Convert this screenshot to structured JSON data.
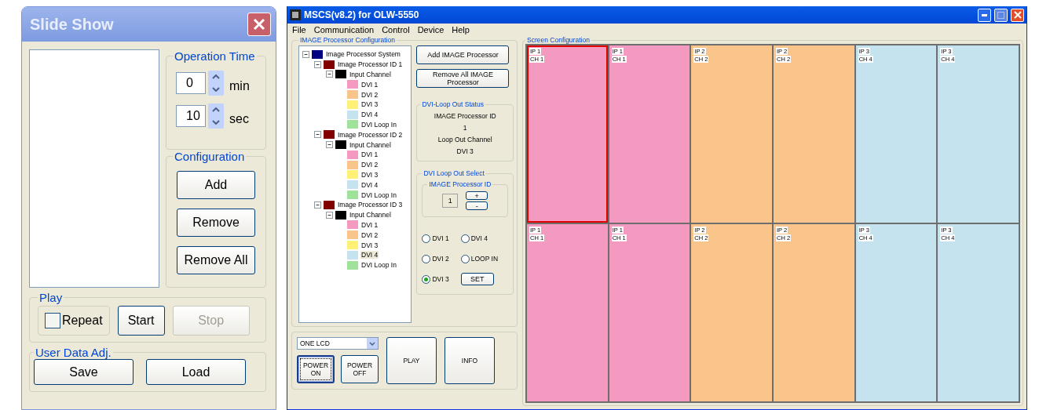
{
  "slide_show": {
    "title": "Slide Show",
    "operation_time": {
      "label": "Operation Time",
      "fields": [
        {
          "value": "0",
          "unit": "min"
        },
        {
          "value": "10",
          "unit": "sec"
        }
      ]
    },
    "configuration": {
      "label": "Configuration",
      "buttons": [
        "Add",
        "Remove",
        "Remove All"
      ]
    },
    "play": {
      "label": "Play",
      "repeat": {
        "label": "Repeat",
        "checked": false
      },
      "buttons": [
        {
          "label": "Start",
          "disabled": false
        },
        {
          "label": "Stop",
          "disabled": true
        }
      ]
    },
    "user_data": {
      "label": "User Data Adj.",
      "buttons": [
        "Save",
        "Load"
      ]
    }
  },
  "main": {
    "title": "MSCS(v8.2) for OLW-5550",
    "menu": [
      "File",
      "Communication",
      "Control",
      "Device",
      "Help"
    ],
    "image_processor_config": {
      "label": "IMAGE  Processor  Configuration",
      "tree": [
        {
          "label": "Image Processor System",
          "color": "#000080",
          "expanded": true,
          "selected": false,
          "children": [
            {
              "label": "Image Processor ID 1",
              "color": "#800000",
              "expanded": true,
              "selected": false,
              "children": [
                {
                  "label": "Input Channel",
                  "color": "#000000",
                  "expanded": true,
                  "selected": false,
                  "children": [
                    {
                      "label": "DVI 1",
                      "color": "#f49ac1",
                      "selected": false
                    },
                    {
                      "label": "DVI 2",
                      "color": "#fac58a",
                      "selected": false
                    },
                    {
                      "label": "DVI 3",
                      "color": "#fff176",
                      "selected": false
                    },
                    {
                      "label": "DVI 4",
                      "color": "#c5e3ef",
                      "selected": false
                    },
                    {
                      "label": "DVI Loop In",
                      "color": "#9fe39a",
                      "selected": false
                    }
                  ]
                }
              ]
            },
            {
              "label": "Image Processor ID 2",
              "color": "#800000",
              "expanded": true,
              "selected": false,
              "children": [
                {
                  "label": "Input Channel",
                  "color": "#000000",
                  "expanded": true,
                  "selected": false,
                  "children": [
                    {
                      "label": "DVI 1",
                      "color": "#f49ac1",
                      "selected": false
                    },
                    {
                      "label": "DVI 2",
                      "color": "#fac58a",
                      "selected": false
                    },
                    {
                      "label": "DVI 3",
                      "color": "#fff176",
                      "selected": false
                    },
                    {
                      "label": "DVI 4",
                      "color": "#c5e3ef",
                      "selected": false
                    },
                    {
                      "label": "DVI Loop In",
                      "color": "#9fe39a",
                      "selected": false
                    }
                  ]
                }
              ]
            },
            {
              "label": "Image Processor ID 3",
              "color": "#800000",
              "expanded": true,
              "selected": false,
              "children": [
                {
                  "label": "Input Channel",
                  "color": "#000000",
                  "expanded": true,
                  "selected": false,
                  "children": [
                    {
                      "label": "DVI 1",
                      "color": "#f49ac1",
                      "selected": false
                    },
                    {
                      "label": "DVI 2",
                      "color": "#fac58a",
                      "selected": false
                    },
                    {
                      "label": "DVI 3",
                      "color": "#fff176",
                      "selected": false
                    },
                    {
                      "label": "DVI 4",
                      "color": "#c5e3ef",
                      "selected": true
                    },
                    {
                      "label": "DVI Loop In",
                      "color": "#9fe39a",
                      "selected": false
                    }
                  ]
                }
              ]
            }
          ]
        }
      ],
      "buttons": [
        "Add IMAGE Processor",
        "Remove All IMAGE Processor"
      ],
      "loop_out_status": {
        "label": "DVI-Loop Out Status",
        "lines": [
          "IMAGE Processor ID",
          "1",
          "Loop Out Channel",
          "DVI 3"
        ]
      },
      "loop_out_select": {
        "label": "DVI Loop Out Select",
        "processor_id": {
          "label": "IMAGE Processor ID",
          "value": "1",
          "buttons": [
            "+",
            "-"
          ]
        },
        "options": [
          {
            "label": "DVI 1",
            "selected": false
          },
          {
            "label": "DVI 2",
            "selected": false
          },
          {
            "label": "DVI 3",
            "selected": true
          },
          {
            "label": "DVI 4",
            "selected": false
          },
          {
            "label": "LOOP IN",
            "selected": false
          }
        ],
        "set_button": "SET"
      }
    },
    "controls": {
      "dropdown": "ONE LCD",
      "buttons": [
        {
          "label": "POWER ON",
          "focused": true
        },
        {
          "label": "POWER OFF",
          "focused": false
        }
      ],
      "large_buttons": [
        "PLAY",
        "INFO"
      ]
    },
    "screen_config": {
      "label": "Screen Configuration",
      "cells": [
        {
          "ip": "IP 1",
          "ch": "CH 1",
          "color": "#f49ac1",
          "selected": true
        },
        {
          "ip": "IP 1",
          "ch": "CH 1",
          "color": "#f49ac1",
          "selected": false
        },
        {
          "ip": "IP 2",
          "ch": "CH 2",
          "color": "#fac58a",
          "selected": false
        },
        {
          "ip": "IP 2",
          "ch": "CH 2",
          "color": "#fac58a",
          "selected": false
        },
        {
          "ip": "IP 3",
          "ch": "CH 4",
          "color": "#c5e3ef",
          "selected": false
        },
        {
          "ip": "IP 3",
          "ch": "CH 4",
          "color": "#c5e3ef",
          "selected": false
        },
        {
          "ip": "IP 1",
          "ch": "CH 1",
          "color": "#f49ac1",
          "selected": false
        },
        {
          "ip": "IP 1",
          "ch": "CH 1",
          "color": "#f49ac1",
          "selected": false
        },
        {
          "ip": "IP 2",
          "ch": "CH 2",
          "color": "#fac58a",
          "selected": false
        },
        {
          "ip": "IP 2",
          "ch": "CH 2",
          "color": "#fac58a",
          "selected": false
        },
        {
          "ip": "IP 3",
          "ch": "CH 4",
          "color": "#c5e3ef",
          "selected": false
        },
        {
          "ip": "IP 3",
          "ch": "CH 4",
          "color": "#c5e3ef",
          "selected": false
        }
      ]
    }
  }
}
